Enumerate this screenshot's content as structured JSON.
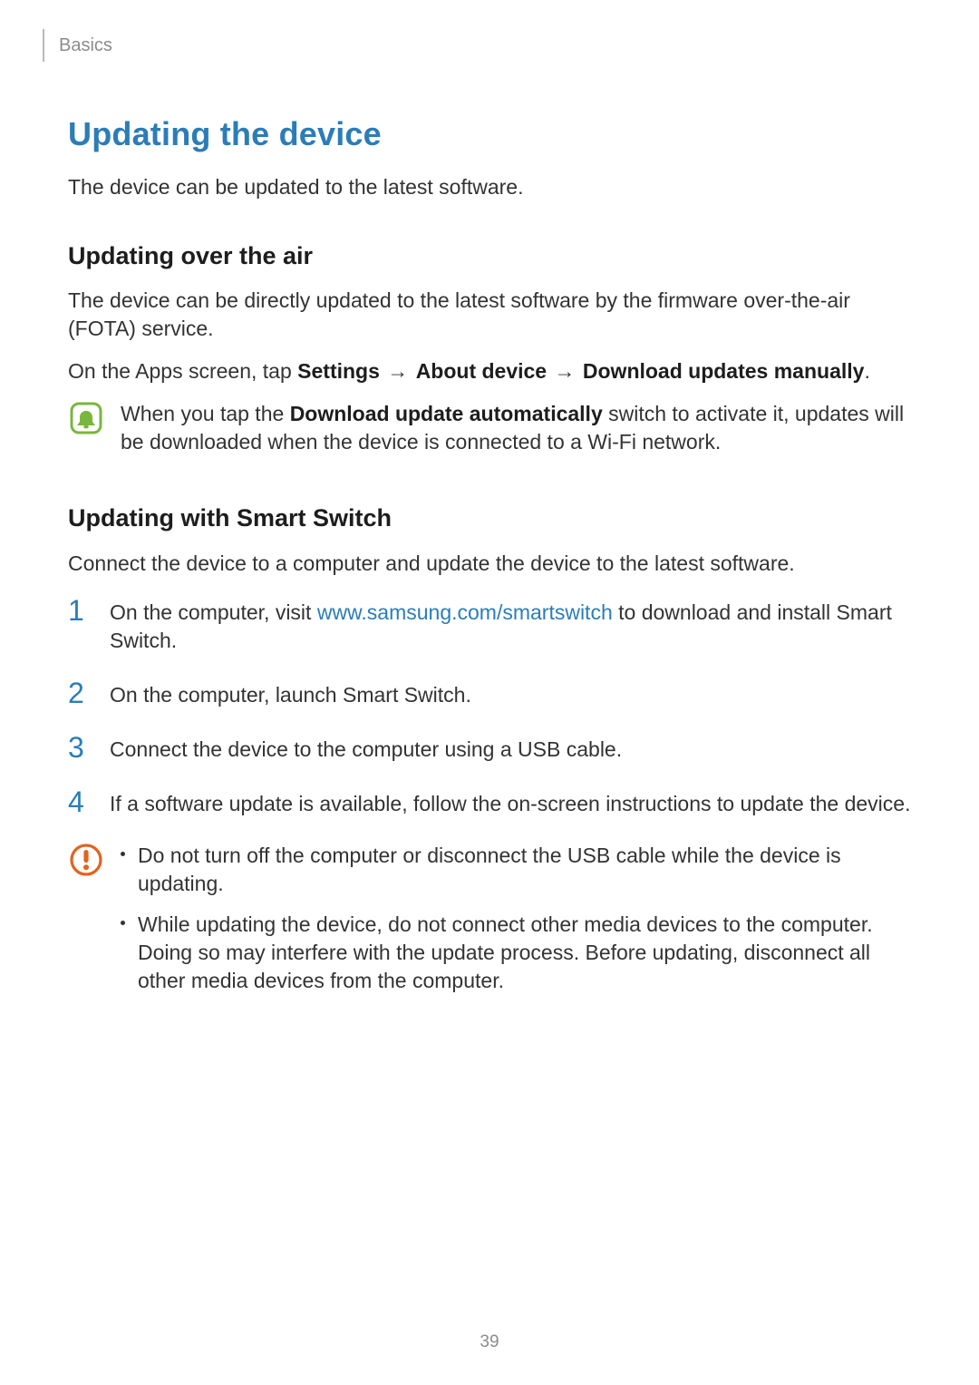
{
  "header": {
    "running_title": "Basics"
  },
  "h1": "Updating the device",
  "intro": "The device can be updated to the latest software.",
  "sec1": {
    "title": "Updating over the air",
    "p1": "The device can be directly updated to the latest software by the firmware over-the-air (FOTA) service.",
    "p2_pre": "On the Apps screen, tap ",
    "p2_b1": "Settings",
    "arrow": "→",
    "p2_b2": "About device",
    "p2_b3": "Download updates manually",
    "p2_post": ".",
    "note_pre": "When you tap the ",
    "note_bold": "Download update automatically",
    "note_post": " switch to activate it, updates will be downloaded when the device is connected to a Wi-Fi network."
  },
  "sec2": {
    "title": "Updating with Smart Switch",
    "p1": "Connect the device to a computer and update the device to the latest software.",
    "steps": [
      {
        "n": "1",
        "pre": "On the computer, visit ",
        "link": "www.samsung.com/smartswitch",
        "post": " to download and install Smart Switch."
      },
      {
        "n": "2",
        "text": "On the computer, launch Smart Switch."
      },
      {
        "n": "3",
        "text": "Connect the device to the computer using a USB cable."
      },
      {
        "n": "4",
        "text": "If a software update is available, follow the on-screen instructions to update the device."
      }
    ],
    "caution": [
      "Do not turn off the computer or disconnect the USB cable while the device is updating.",
      "While updating the device, do not connect other media devices to the computer. Doing so may interfere with the update process. Before updating, disconnect all other media devices from the computer."
    ]
  },
  "page_number": "39"
}
